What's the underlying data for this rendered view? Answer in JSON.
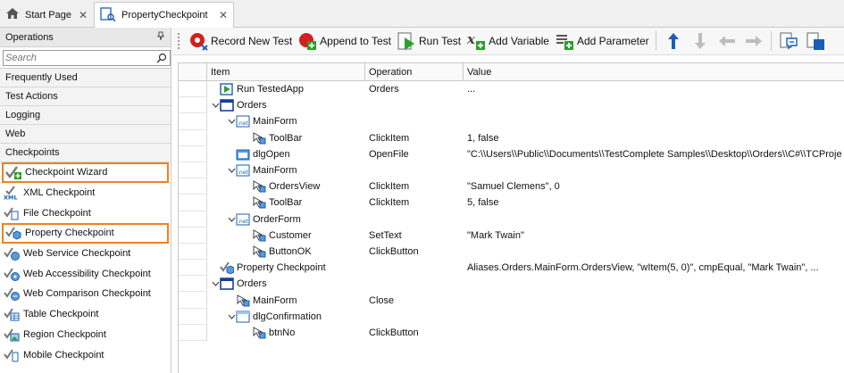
{
  "tabs": [
    {
      "label": "Start Page",
      "icon": "home-icon"
    },
    {
      "label": "PropertyCheckpoint",
      "icon": "keyword-test-icon"
    }
  ],
  "left_panel": {
    "title": "Operations",
    "search_placeholder": "Search",
    "categories": [
      "Frequently Used",
      "Test Actions",
      "Logging",
      "Web",
      "Checkpoints"
    ],
    "items": [
      {
        "label": "Checkpoint Wizard",
        "icon": "checkpoint-wizard-icon",
        "highlight": true
      },
      {
        "label": "XML Checkpoint",
        "icon": "xml-checkpoint-icon",
        "highlight": false
      },
      {
        "label": "File Checkpoint",
        "icon": "file-checkpoint-icon",
        "highlight": false
      },
      {
        "label": "Property Checkpoint",
        "icon": "property-checkpoint-icon",
        "highlight": true
      },
      {
        "label": "Web Service Checkpoint",
        "icon": "web-service-checkpoint-icon",
        "highlight": false
      },
      {
        "label": "Web Accessibility Checkpoint",
        "icon": "web-accessibility-checkpoint-icon",
        "highlight": false
      },
      {
        "label": "Web Comparison Checkpoint",
        "icon": "web-comparison-checkpoint-icon",
        "highlight": false
      },
      {
        "label": "Table Checkpoint",
        "icon": "table-checkpoint-icon",
        "highlight": false
      },
      {
        "label": "Region Checkpoint",
        "icon": "region-checkpoint-icon",
        "highlight": false
      },
      {
        "label": "Mobile Checkpoint",
        "icon": "mobile-checkpoint-icon",
        "highlight": false
      }
    ]
  },
  "toolbar": {
    "record_new_test": "Record New Test",
    "append_to_test": "Append to Test",
    "run_test": "Run Test",
    "add_variable": "Add Variable",
    "add_parameter": "Add Parameter"
  },
  "grid": {
    "columns": {
      "item": "Item",
      "operation": "Operation",
      "value": "Value"
    },
    "rows": [
      {
        "level": 0,
        "toggle": "",
        "icon": "run-app-icon",
        "item": "Run TestedApp",
        "operation": "Orders",
        "value": "..."
      },
      {
        "level": 0,
        "toggle": "v",
        "icon": "process-window-icon",
        "item": "Orders",
        "operation": "",
        "value": ""
      },
      {
        "level": 1,
        "toggle": "v",
        "icon": "net-form-icon",
        "item": "MainForm",
        "operation": "",
        "value": ""
      },
      {
        "level": 2,
        "toggle": "",
        "icon": "control-icon",
        "item": "ToolBar",
        "operation": "ClickItem",
        "value": "1, false"
      },
      {
        "level": 1,
        "toggle": "",
        "icon": "dialog-icon",
        "item": "dlgOpen",
        "operation": "OpenFile",
        "value": "\"C:\\\\Users\\\\Public\\\\Documents\\\\TestComplete Samples\\\\Desktop\\\\Orders\\\\C#\\\\TCProje"
      },
      {
        "level": 1,
        "toggle": "v",
        "icon": "net-form-icon",
        "item": "MainForm",
        "operation": "",
        "value": ""
      },
      {
        "level": 2,
        "toggle": "",
        "icon": "control-icon",
        "item": "OrdersView",
        "operation": "ClickItem",
        "value": "\"Samuel Clemens\", 0"
      },
      {
        "level": 2,
        "toggle": "",
        "icon": "control-icon",
        "item": "ToolBar",
        "operation": "ClickItem",
        "value": "5, false"
      },
      {
        "level": 1,
        "toggle": "v",
        "icon": "net-form-icon",
        "item": "OrderForm",
        "operation": "",
        "value": ""
      },
      {
        "level": 2,
        "toggle": "",
        "icon": "control-icon",
        "item": "Customer",
        "operation": "SetText",
        "value": "\"Mark Twain\""
      },
      {
        "level": 2,
        "toggle": "",
        "icon": "control-icon",
        "item": "ButtonOK",
        "operation": "ClickButton",
        "value": ""
      },
      {
        "level": 0,
        "toggle": "",
        "icon": "property-checkpoint-icon",
        "item": "Property Checkpoint",
        "operation": "",
        "value": "Aliases.Orders.MainForm.OrdersView, \"wItem(5, 0)\", cmpEqual, \"Mark Twain\", ..."
      },
      {
        "level": 0,
        "toggle": "v",
        "icon": "process-window-icon",
        "item": "Orders",
        "operation": "",
        "value": ""
      },
      {
        "level": 1,
        "toggle": "",
        "icon": "control-icon",
        "item": "MainForm",
        "operation": "Close",
        "value": ""
      },
      {
        "level": 1,
        "toggle": "v",
        "icon": "dialog-window-icon",
        "item": "dlgConfirmation",
        "operation": "",
        "value": ""
      },
      {
        "level": 2,
        "toggle": "",
        "icon": "control-icon",
        "item": "btnNo",
        "operation": "ClickButton",
        "value": ""
      }
    ]
  },
  "colors": {
    "highlight_outline": "#f08020",
    "accent_blue": "#1a5fb4",
    "green": "#2aa12a",
    "red": "#d21f1f"
  }
}
